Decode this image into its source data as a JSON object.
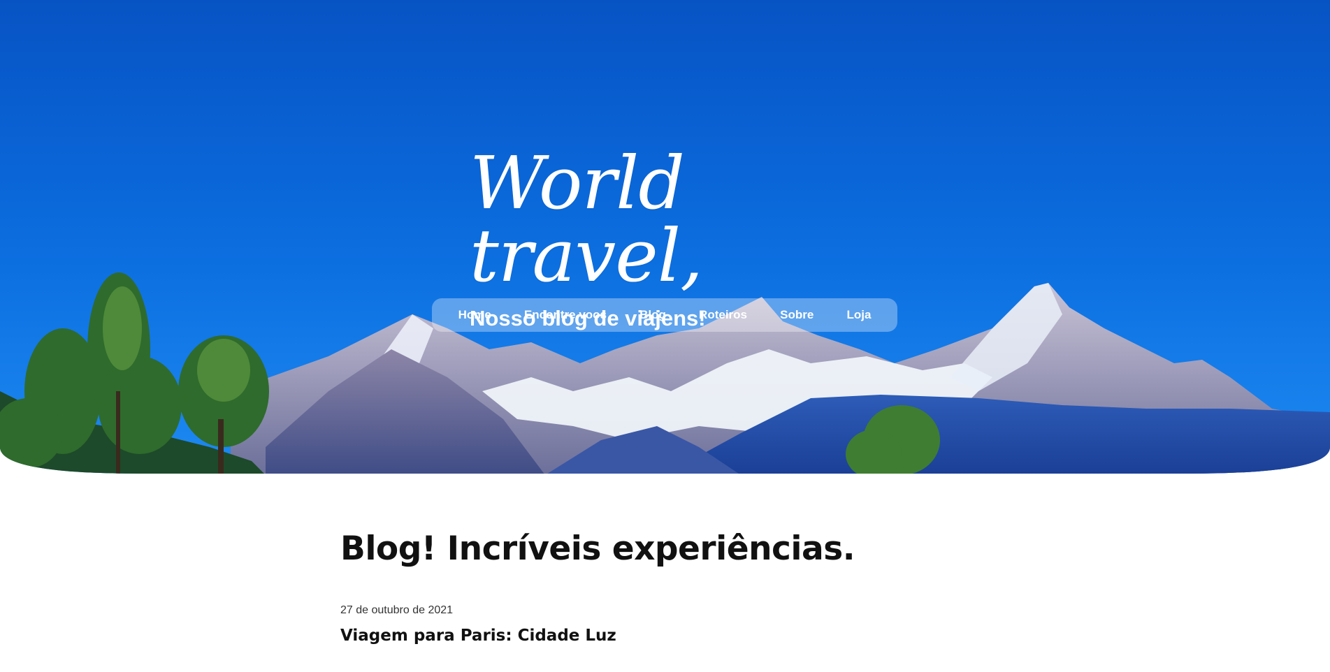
{
  "brand": {
    "logo_text": "World travel,",
    "tagline": "Nosso blog de viajens!"
  },
  "nav": {
    "items": [
      {
        "label": "Home"
      },
      {
        "label": "Encontre voos"
      },
      {
        "label": "Blog"
      },
      {
        "label": "Roteiros"
      },
      {
        "label": "Sobre"
      },
      {
        "label": "Loja"
      }
    ]
  },
  "blog": {
    "heading": "Blog! Incríveis experiências.",
    "posts": [
      {
        "date": "27 de outubro de 2021",
        "title": "Viagem para Paris: Cidade Luz"
      }
    ]
  },
  "colors": {
    "sky_top": "#0a4fc0",
    "sky_bottom": "#1f86f0",
    "text_dark": "#111111",
    "white": "#ffffff"
  }
}
